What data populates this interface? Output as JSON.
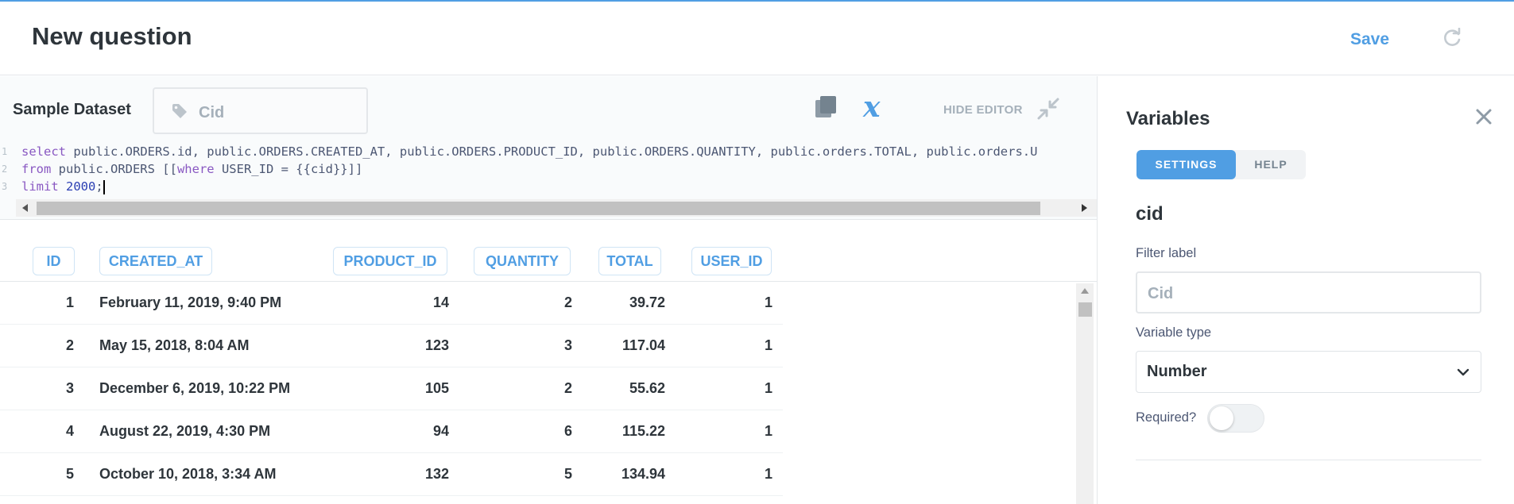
{
  "header": {
    "title": "New question",
    "save_label": "Save"
  },
  "editor": {
    "database": "Sample Dataset",
    "variable_placeholder": "Cid",
    "hide_editor_label": "HIDE EDITOR",
    "lines": [
      {
        "num": "1",
        "parts": [
          {
            "t": "select",
            "c": "kw"
          },
          {
            "t": " public.ORDERS.id, public.ORDERS.CREATED_AT, public.ORDERS.PRODUCT_ID, public.ORDERS.QUANTITY, public.orders.TOTAL, public.orders.U",
            "c": ""
          }
        ]
      },
      {
        "num": "2",
        "parts": [
          {
            "t": "from",
            "c": "kw"
          },
          {
            "t": " public.ORDERS [[",
            "c": ""
          },
          {
            "t": "where",
            "c": "kw"
          },
          {
            "t": " USER_ID = {{cid}}]]",
            "c": ""
          }
        ]
      },
      {
        "num": "3",
        "parts": [
          {
            "t": "limit",
            "c": "kw"
          },
          {
            "t": " ",
            "c": ""
          },
          {
            "t": "2000",
            "c": "num"
          },
          {
            "t": ";",
            "c": ""
          }
        ]
      }
    ]
  },
  "table": {
    "columns": [
      "ID",
      "CREATED_AT",
      "PRODUCT_ID",
      "QUANTITY",
      "TOTAL",
      "USER_ID"
    ],
    "rows": [
      [
        "1",
        "February 11, 2019, 9:40 PM",
        "14",
        "2",
        "39.72",
        "1"
      ],
      [
        "2",
        "May 15, 2018, 8:04 AM",
        "123",
        "3",
        "117.04",
        "1"
      ],
      [
        "3",
        "December 6, 2019, 10:22 PM",
        "105",
        "2",
        "55.62",
        "1"
      ],
      [
        "4",
        "August 22, 2019, 4:30 PM",
        "94",
        "6",
        "115.22",
        "1"
      ],
      [
        "5",
        "October 10, 2018, 3:34 AM",
        "132",
        "5",
        "134.94",
        "1"
      ]
    ]
  },
  "panel": {
    "title": "Variables",
    "tabs": [
      "SETTINGS",
      "HELP"
    ],
    "variable_name": "cid",
    "filter_label_label": "Filter label",
    "filter_label_placeholder": "Cid",
    "variable_type_label": "Variable type",
    "variable_type_value": "Number",
    "required_label": "Required?",
    "required": false
  },
  "colors": {
    "accent": "#509ee3",
    "text": "#2e353b",
    "muted": "#a5b0ba",
    "sql_keyword": "#8958c2"
  }
}
